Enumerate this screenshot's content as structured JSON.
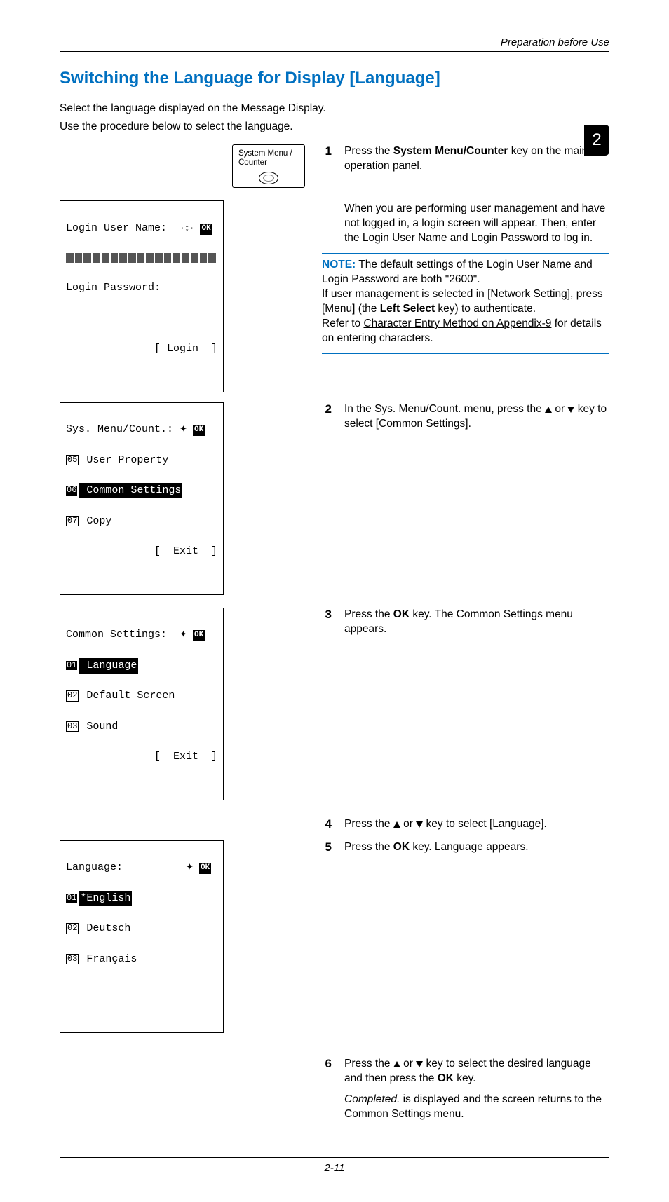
{
  "header": {
    "section": "Preparation before Use"
  },
  "page_tab": "2",
  "title": "Switching the Language for Display [Language]",
  "intro": [
    "Select the language displayed on the Message Display.",
    "Use the procedure below to select the language."
  ],
  "key_button": {
    "line1": "System Menu /",
    "line2": "Counter"
  },
  "lcd_login": {
    "row1": "Login User Name:",
    "row2": "Login Password:",
    "row3": "[ Login  ]"
  },
  "steps": {
    "s1": {
      "num": "1",
      "pre": "Press the ",
      "bold": "System Menu/Counter",
      "post": " key on the main unit operation panel."
    },
    "login_text": "When you are performing user management and have not logged in, a login screen will appear. Then, enter the Login User Name and Login Password to log in.",
    "note_label": "NOTE:",
    "note_line1": " The default settings of the Login User Name and Login Password are both \"2600\".",
    "note_line2a": "If user management is selected in [Network Setting], press [Menu] (the ",
    "note_line2b": "Left Select",
    "note_line2c": " key) to authenticate.",
    "note_line3a": "Refer to ",
    "note_line3_link": "Character Entry Method on Appendix-9",
    "note_line3b": " for details on entering characters.",
    "s2": {
      "num": "2",
      "text_a": "In the Sys. Menu/Count. menu, press the ",
      "text_b": " or ",
      "text_c": " key to select [Common Settings]."
    },
    "s3": {
      "num": "3",
      "text_a": "Press the ",
      "bold": "OK",
      "text_b": " key. The Common Settings menu appears."
    },
    "s4": {
      "num": "4",
      "text_a": "Press the ",
      "text_b": " or ",
      "text_c": " key to select [Language]."
    },
    "s5": {
      "num": "5",
      "text_a": "Press the ",
      "bold": "OK",
      "text_b": " key. Language appears."
    },
    "s6": {
      "num": "6",
      "text_a": "Press the ",
      "text_b": " or ",
      "text_c": " key to select the desired language and then press the ",
      "bold": "OK",
      "text_d": " key."
    },
    "s6_after": {
      "ital": "Completed.",
      "rest": " is displayed and the screen returns to the Common Settings menu."
    }
  },
  "lcd_sys": {
    "title": "Sys. Menu/Count.:",
    "i5": "5",
    "l5": " User Property",
    "i6": "6",
    "l6": " Common Settings",
    "i7": "7",
    "l7": " Copy",
    "foot": "[  Exit  ]"
  },
  "lcd_common": {
    "title": "Common Settings:",
    "i1": "1",
    "l1": " Language",
    "i2": "2",
    "l2": " Default Screen",
    "i3": "3",
    "l3": " Sound",
    "foot": "[  Exit  ]"
  },
  "lcd_lang": {
    "title": "Language:",
    "i1": "1",
    "l1": "*English",
    "i2": "2",
    "l2": " Deutsch",
    "i3": "3",
    "l3": " Français"
  },
  "page_number": "2-11"
}
